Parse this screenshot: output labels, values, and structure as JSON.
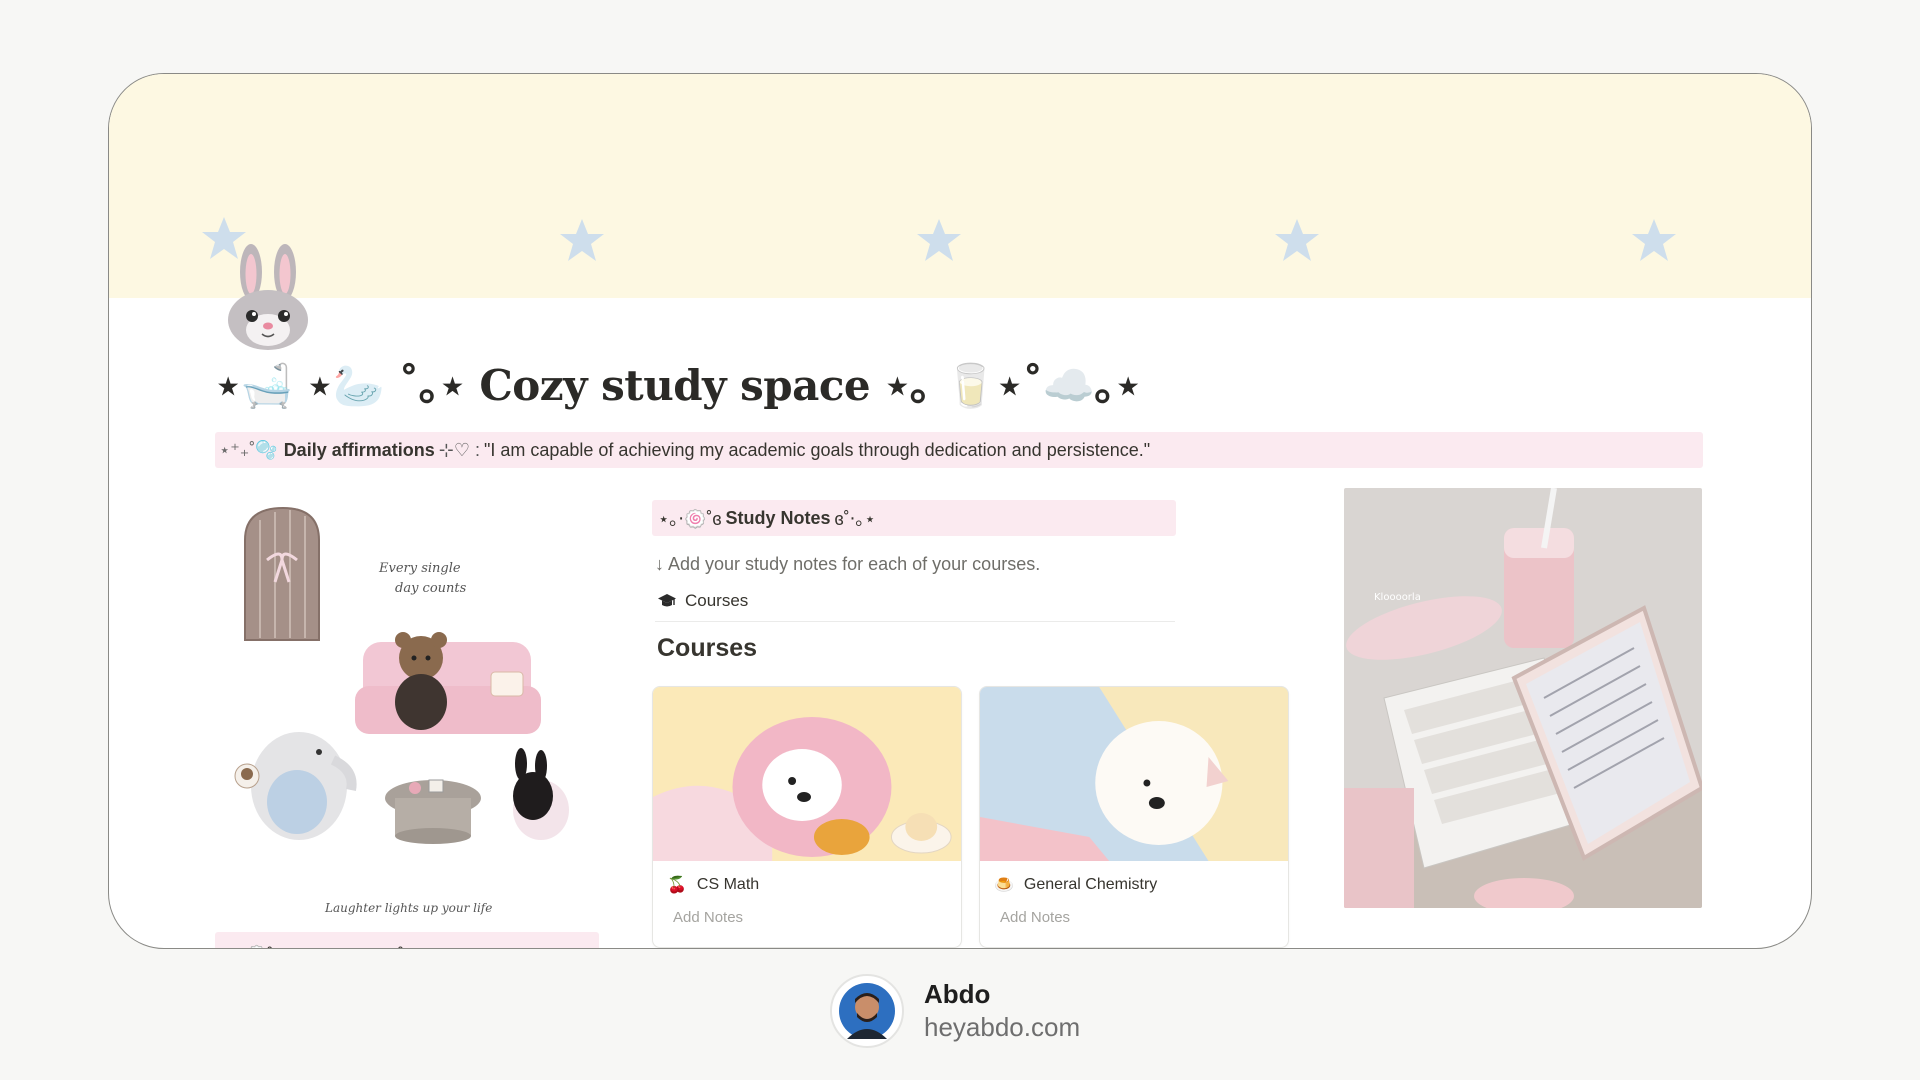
{
  "page": {
    "title": "⋆🛁 ⋆🦢 ˚｡⋆ Cozy study space ⋆｡ 🥛⋆˚☁️｡⋆",
    "icon": "rabbit-face-icon"
  },
  "affirmation": {
    "deco": "⋆⁺₊˚🫧",
    "label": "Daily affirmations",
    "heart": "⊹♡ :",
    "text": "\"I am capable of achieving my academic goals through dedication and persistence.\""
  },
  "illustration": {
    "line1": "Every single",
    "line2": "day counts",
    "caption": "Laughter lights up your life"
  },
  "navigation": {
    "label": "⋆｡‧🍥˚ɞ Navigations ɞ˚‧｡⋆"
  },
  "study_notes": {
    "prefix": "⋆｡‧🍥˚ɞ",
    "label": "Study Notes",
    "suffix": "ɞ˚‧｡⋆",
    "hint": "↓ Add your study notes for each of your courses.",
    "link_icon": "graduation-cap-icon",
    "link_label": "Courses"
  },
  "courses": {
    "heading": "Courses",
    "cards": [
      {
        "emoji": "🍒",
        "title": "CS Math",
        "sub": "Add Notes"
      },
      {
        "emoji": "🍮",
        "title": "General Chemistry",
        "sub": "Add Notes"
      }
    ]
  },
  "photo": {
    "label": "Kloooorla"
  },
  "footer": {
    "name": "Abdo",
    "site": "heyabdo.com"
  },
  "colors": {
    "cover": "#fdf8e2",
    "callout": "#fbeaf0",
    "star": "#c6dbef"
  }
}
